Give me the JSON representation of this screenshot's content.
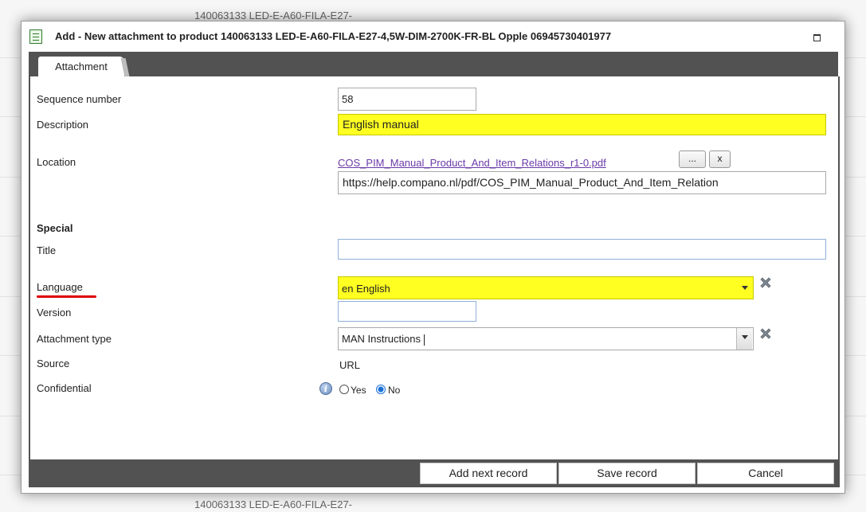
{
  "background": {
    "top_row_text": "140063133 LED-E-A60-FILA-E27-",
    "bottom_row_text": "140063133 LED-E-A60-FILA-E27-"
  },
  "dialog": {
    "title": "Add - New attachment to product 140063133 LED-E-A60-FILA-E27-4,5W-DIM-2700K-FR-BL Opple 06945730401977",
    "title_icon": "form-icon",
    "maximize_icon": "maximize-icon",
    "tab_label": "Attachment"
  },
  "form": {
    "sequence_number_label": "Sequence number",
    "sequence_number_value": "58",
    "description_label": "Description",
    "description_value": "English manual",
    "location_label": "Location",
    "location_link": "COS_PIM_Manual_Product_And_Item_Relations_r1-0.pdf",
    "browse_label": "...",
    "clear_label": "x",
    "location_url": "https://help.compano.nl/pdf/COS_PIM_Manual_Product_And_Item_Relation",
    "special_heading": "Special",
    "title_label": "Title",
    "title_value": "",
    "language_label": "Language",
    "language_value": "en English",
    "version_label": "Version",
    "version_value": "",
    "attachment_type_label": "Attachment type",
    "attachment_type_value": "MAN Instructions",
    "source_label": "Source",
    "source_value": "URL",
    "confidential_label": "Confidential",
    "confidential_yes": "Yes",
    "confidential_no": "No",
    "confidential_selected": "No"
  },
  "footer": {
    "add_next_label": "Add next record",
    "save_label": "Save record",
    "cancel_label": "Cancel"
  },
  "colors": {
    "required_highlight": "#ffff22",
    "frame_gray": "#525252",
    "link_purple": "#6a3aa8",
    "language_underline": "#d00000"
  }
}
